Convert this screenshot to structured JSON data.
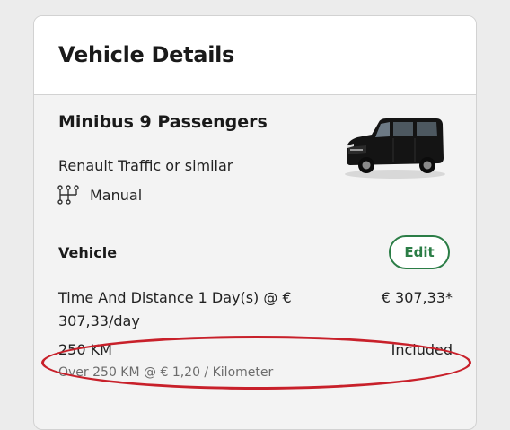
{
  "header": {
    "title": "Vehicle Details"
  },
  "vehicle": {
    "name": "Minibus 9 Passengers",
    "model": "Renault Traffic or similar",
    "transmission": "Manual",
    "transmission_icon": "gear-shift-icon",
    "image": "black-minibus-van"
  },
  "pricing": {
    "section_label": "Vehicle",
    "edit_label": "Edit",
    "rate_description": "Time And Distance 1 Day(s) @ € 307,33/day",
    "rate_price": "€ 307,33*",
    "mileage_label": "250 KM",
    "mileage_status": "Included",
    "mileage_extra": "Over 250 KM @ € 1,20 / Kilometer"
  },
  "colors": {
    "accent": "#2b7d46",
    "highlight": "#c8202a"
  }
}
